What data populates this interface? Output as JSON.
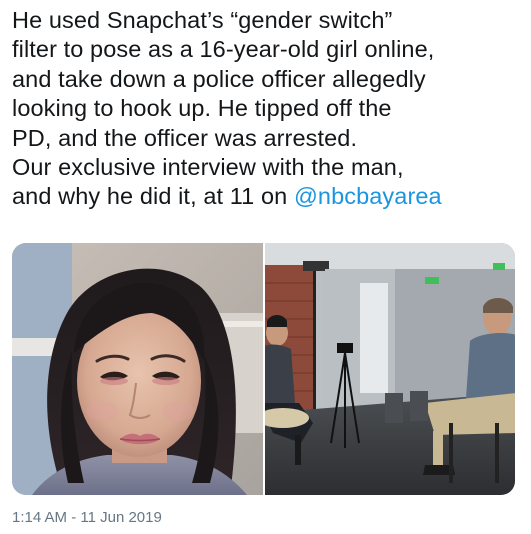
{
  "tweet": {
    "lines": [
      "He used Snapchat’s “gender switch”",
      "filter to pose as a 16-year-old girl online,",
      "and take down a police officer allegedly",
      "looking to hook up. He tipped off the",
      "PD, and the officer was arrested.",
      "Our exclusive interview with the man,",
      "and why he did it, at 11 on "
    ],
    "mention": "@nbcbayarea",
    "timestamp": "1:14 AM - 11 Jun 2019"
  },
  "media": {
    "photos": [
      {
        "icon": "selfie-photo-icon"
      },
      {
        "icon": "interview-photo-icon"
      }
    ]
  },
  "colors": {
    "text": "#14171a",
    "link": "#1b95e0",
    "meta": "#657786"
  }
}
